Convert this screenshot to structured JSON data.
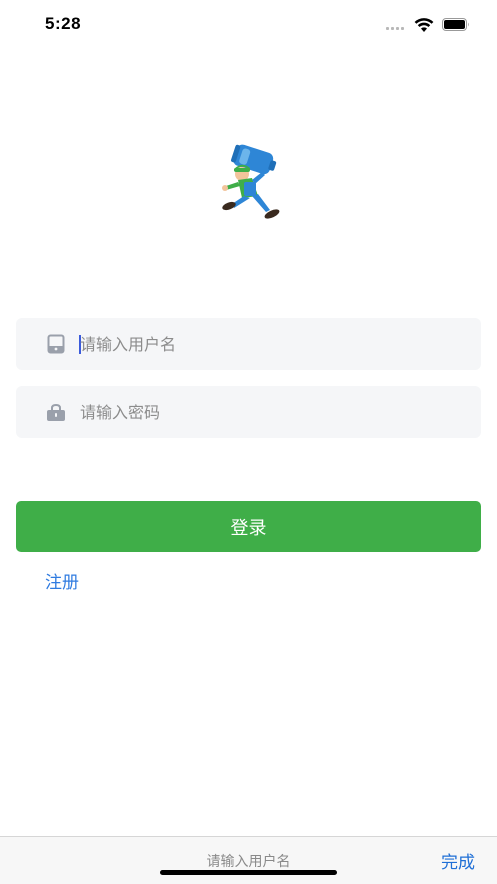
{
  "status_bar": {
    "time": "5:28"
  },
  "login_form": {
    "username": {
      "placeholder": "请输入用户名",
      "value": "",
      "icon": "phone-icon"
    },
    "password": {
      "placeholder": "请输入密码",
      "value": "",
      "icon": "lock-icon"
    },
    "login_label": "登录",
    "register_label": "注册"
  },
  "keyboard_accessory": {
    "hint": "请输入用户名",
    "done_label": "完成"
  },
  "colors": {
    "primary_green": "#3fae48",
    "link_blue": "#2f7be0",
    "field_background": "#f5f6f8"
  }
}
